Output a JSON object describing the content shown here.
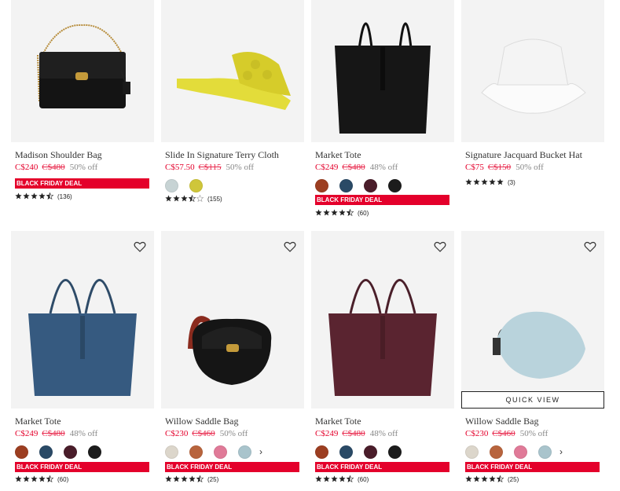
{
  "row1": [
    {
      "name": "Madison Shoulder Bag",
      "price": "C$240",
      "orig": "C$480",
      "off": "50% off",
      "swatches": [],
      "deal": "BLACK FRIDAY DEAL",
      "rating_stars": 4.5,
      "count": "(136)"
    },
    {
      "name": "Slide In Signature Terry Cloth",
      "price": "C$57.50",
      "orig": "C$115",
      "off": "50% off",
      "swatches": [
        "#c7d3d4",
        "#cfc63a"
      ],
      "deal": "",
      "rating_stars": 3.5,
      "count": "(155)"
    },
    {
      "name": "Market Tote",
      "price": "C$249",
      "orig": "C$480",
      "off": "48% off",
      "swatches": [
        "#9c3e21",
        "#2a4a66",
        "#4a1d2a",
        "#1c1c1c"
      ],
      "deal": "BLACK FRIDAY DEAL",
      "rating_stars": 4.5,
      "count": "(60)"
    },
    {
      "name": "Signature Jacquard Bucket Hat",
      "price": "C$75",
      "orig": "C$150",
      "off": "50% off",
      "swatches": [],
      "deal": "",
      "rating_stars": 5,
      "count": "(3)"
    }
  ],
  "row2": [
    {
      "name": "Market Tote",
      "price": "C$249",
      "orig": "C$480",
      "off": "48% off",
      "swatches": [
        "#9c3e21",
        "#2a4a66",
        "#4a1d2a",
        "#1c1c1c"
      ],
      "more": false,
      "deal": "BLACK FRIDAY DEAL",
      "rating_stars": 4.5,
      "count": "(60)"
    },
    {
      "name": "Willow Saddle Bag",
      "price": "C$230",
      "orig": "C$460",
      "off": "50% off",
      "swatches": [
        "#dcd6cb",
        "#b8643d",
        "#e07a98",
        "#a9c4cc"
      ],
      "more": true,
      "deal": "BLACK FRIDAY DEAL",
      "rating_stars": 4.5,
      "count": "(25)"
    },
    {
      "name": "Market Tote",
      "price": "C$249",
      "orig": "C$480",
      "off": "48% off",
      "swatches": [
        "#9c3e21",
        "#2a4a66",
        "#4a1d2a",
        "#1c1c1c"
      ],
      "more": false,
      "deal": "BLACK FRIDAY DEAL",
      "rating_stars": 4.5,
      "count": "(60)"
    },
    {
      "name": "Willow Saddle Bag",
      "price": "C$230",
      "orig": "C$460",
      "off": "50% off",
      "swatches": [
        "#dcd6cb",
        "#b8643d",
        "#e07a98",
        "#a9c4cc"
      ],
      "more": true,
      "deal": "BLACK FRIDAY DEAL",
      "rating_stars": 4.5,
      "count": "(25)"
    }
  ],
  "quick_view": "QUICK VIEW",
  "more_chevron": "›",
  "icons": {
    "wishlist": "heart-icon",
    "star": "star-icon"
  },
  "colors": {
    "sale_red": "#e4002b",
    "deal_bg": "#e4002b"
  }
}
